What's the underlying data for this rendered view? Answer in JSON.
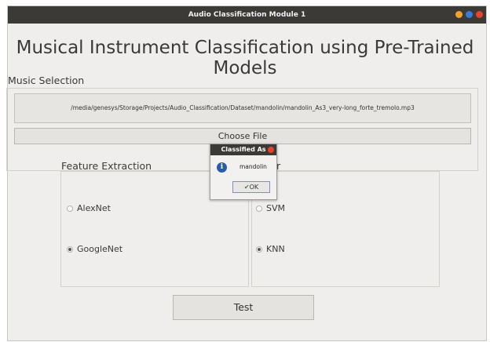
{
  "window": {
    "title": "Audio Classification Module 1",
    "buttons": [
      {
        "name": "minimize-dot-icon",
        "color": "#f0a22d"
      },
      {
        "name": "maximize-dot-icon",
        "color": "#3a7ad9"
      },
      {
        "name": "close-dot-icon",
        "color": "#e8412c"
      }
    ]
  },
  "heading": "Musical Instrument Classification using Pre-Trained Models",
  "music_selection": {
    "label": "Music Selection",
    "path": "/media/genesys/Storage/Projects/Audio_Classification/Dataset/mandolin/mandolin_As3_very-long_forte_tremolo.mp3",
    "choose_button": "Choose File"
  },
  "feature_extraction": {
    "label": "Feature Extraction",
    "options": [
      {
        "label": "AlexNet",
        "checked": false
      },
      {
        "label": "GoogleNet",
        "checked": true
      }
    ]
  },
  "classifier": {
    "label_visible": "r",
    "options": [
      {
        "label": "SVM",
        "checked": false
      },
      {
        "label": "KNN",
        "checked": true
      }
    ]
  },
  "test_button": "Test",
  "dialog": {
    "title": "Classified As",
    "message": "mandolin",
    "ok_label": "OK",
    "icon": "info-icon",
    "close_color": "#e8412c"
  }
}
